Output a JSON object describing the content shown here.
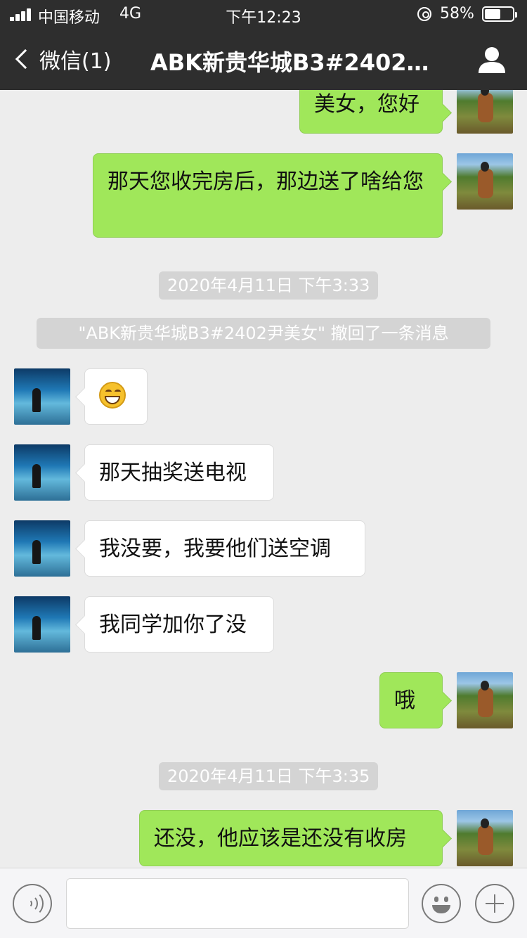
{
  "status_bar": {
    "carrier": "中国移动",
    "network": "4G",
    "time": "下午12:23",
    "battery_percent": "58%",
    "battery_level": 0.58
  },
  "nav": {
    "back_label": "微信(1)",
    "title": "ABK新贵华城B3#2402…"
  },
  "messages": {
    "m1": "美女，您好",
    "m2": "那天您收完房后，那边送了啥给您",
    "time1": "2020年4月11日 下午3:33",
    "recall": "\"ABK新贵华城B3#2402尹美女\" 撤回了一条消息",
    "m3_emoji": "grinning-emoji",
    "m4": "那天抽奖送电视",
    "m5": "我没要，我要他们送空调",
    "m6": "我同学加你了没",
    "m7": "哦",
    "time2": "2020年4月11日 下午3:35",
    "m8": "还没，他应该是还没有收房"
  },
  "colors": {
    "nav_bg": "#2e2e2e",
    "chat_bg": "#ededed",
    "sent_bubble": "#a0e75a",
    "received_bubble": "#ffffff"
  },
  "input_bar": {
    "voice_icon": "voice-icon",
    "emoji_icon": "emoji-icon",
    "plus_icon": "plus-icon"
  }
}
